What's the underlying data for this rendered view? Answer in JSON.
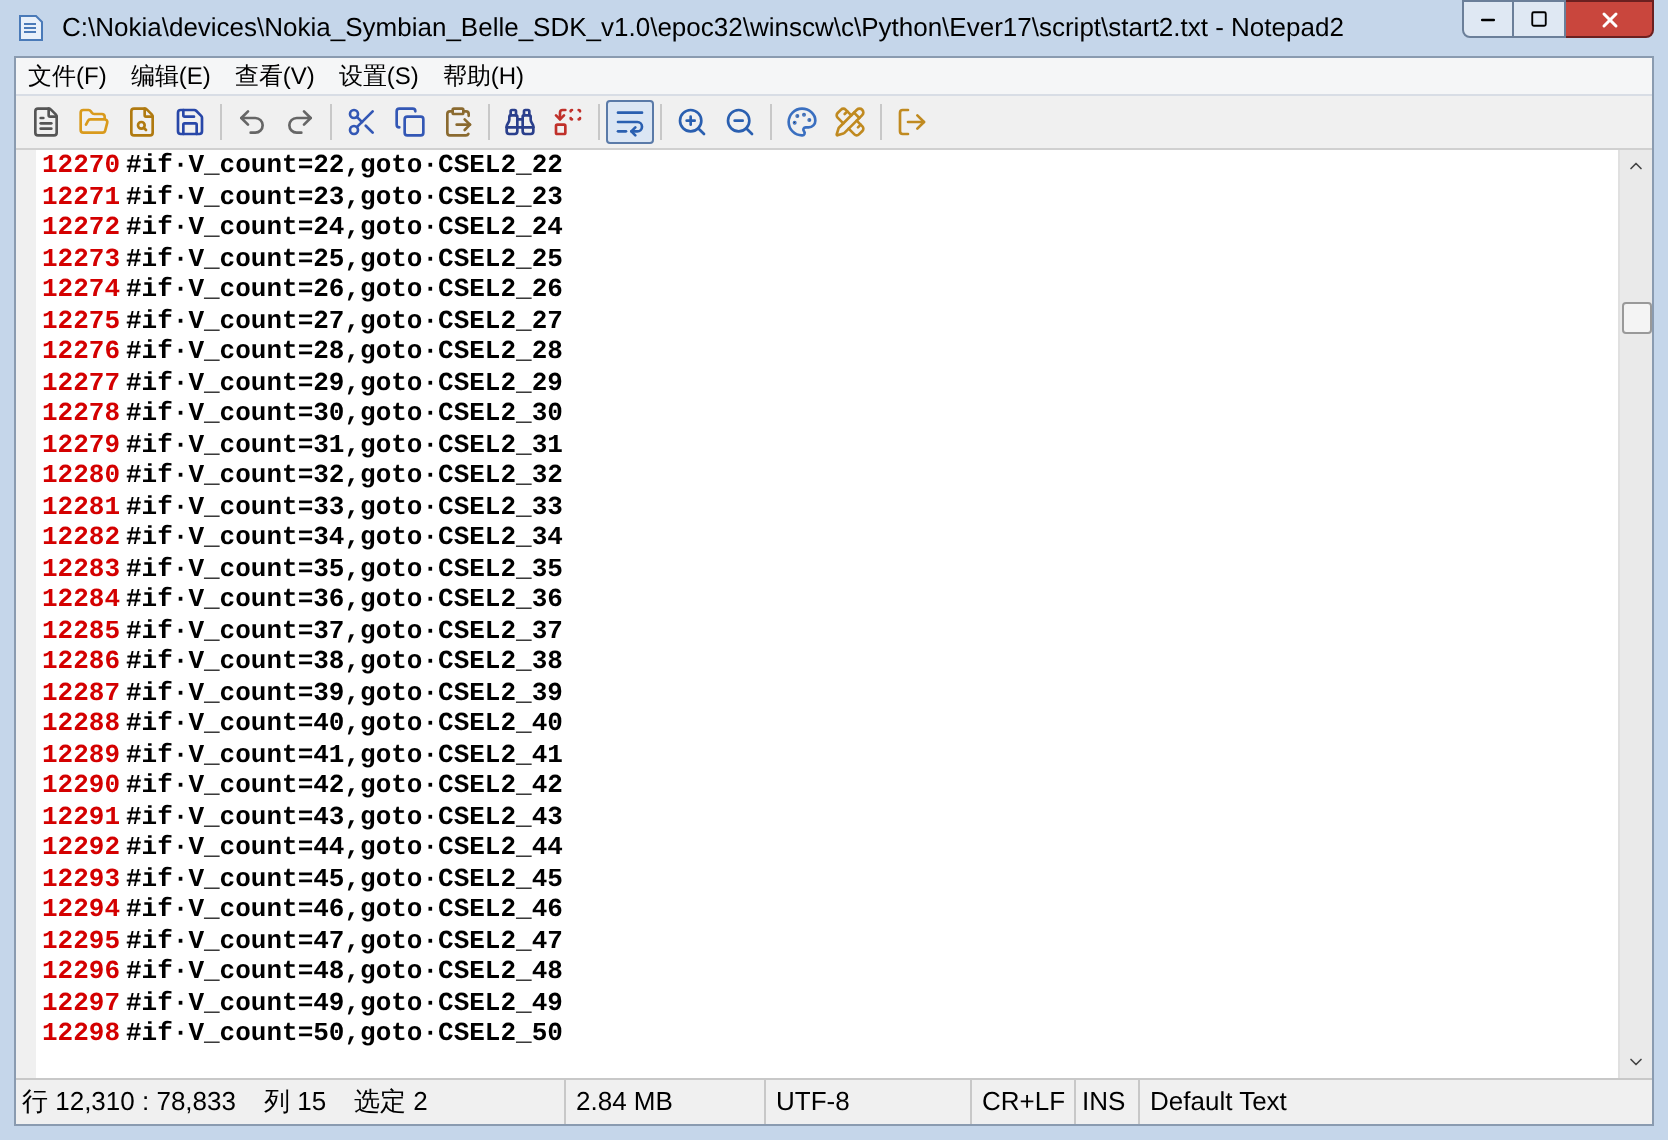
{
  "window": {
    "title": "C:\\Nokia\\devices\\Nokia_Symbian_Belle_SDK_v1.0\\epoc32\\winscw\\c\\Python\\Ever17\\script\\start2.txt - Notepad2"
  },
  "menu": [
    "文件(F)",
    "编辑(E)",
    "查看(V)",
    "设置(S)",
    "帮助(H)"
  ],
  "toolbar": [
    {
      "kind": "new",
      "pressed": false
    },
    {
      "kind": "open",
      "pressed": false
    },
    {
      "kind": "browse",
      "pressed": false
    },
    {
      "kind": "save",
      "pressed": false
    },
    {
      "kind": "sep"
    },
    {
      "kind": "undo",
      "pressed": false
    },
    {
      "kind": "redo",
      "pressed": false
    },
    {
      "kind": "sep"
    },
    {
      "kind": "cut",
      "pressed": false
    },
    {
      "kind": "copy",
      "pressed": false
    },
    {
      "kind": "paste",
      "pressed": false
    },
    {
      "kind": "sep"
    },
    {
      "kind": "find",
      "pressed": false
    },
    {
      "kind": "replace",
      "pressed": false
    },
    {
      "kind": "sep"
    },
    {
      "kind": "wrap",
      "pressed": true
    },
    {
      "kind": "sep"
    },
    {
      "kind": "zoomin",
      "pressed": false
    },
    {
      "kind": "zoomout",
      "pressed": false
    },
    {
      "kind": "sep"
    },
    {
      "kind": "scheme",
      "pressed": false
    },
    {
      "kind": "customize",
      "pressed": false
    },
    {
      "kind": "sep"
    },
    {
      "kind": "exit",
      "pressed": false
    }
  ],
  "editor": {
    "lines": [
      {
        "number": "12270",
        "text": "#if·V_count=22,goto·CSEL2_22"
      },
      {
        "number": "12271",
        "text": "#if·V_count=23,goto·CSEL2_23"
      },
      {
        "number": "12272",
        "text": "#if·V_count=24,goto·CSEL2_24"
      },
      {
        "number": "12273",
        "text": "#if·V_count=25,goto·CSEL2_25"
      },
      {
        "number": "12274",
        "text": "#if·V_count=26,goto·CSEL2_26"
      },
      {
        "number": "12275",
        "text": "#if·V_count=27,goto·CSEL2_27"
      },
      {
        "number": "12276",
        "text": "#if·V_count=28,goto·CSEL2_28"
      },
      {
        "number": "12277",
        "text": "#if·V_count=29,goto·CSEL2_29"
      },
      {
        "number": "12278",
        "text": "#if·V_count=30,goto·CSEL2_30"
      },
      {
        "number": "12279",
        "text": "#if·V_count=31,goto·CSEL2_31"
      },
      {
        "number": "12280",
        "text": "#if·V_count=32,goto·CSEL2_32"
      },
      {
        "number": "12281",
        "text": "#if·V_count=33,goto·CSEL2_33"
      },
      {
        "number": "12282",
        "text": "#if·V_count=34,goto·CSEL2_34"
      },
      {
        "number": "12283",
        "text": "#if·V_count=35,goto·CSEL2_35"
      },
      {
        "number": "12284",
        "text": "#if·V_count=36,goto·CSEL2_36"
      },
      {
        "number": "12285",
        "text": "#if·V_count=37,goto·CSEL2_37"
      },
      {
        "number": "12286",
        "text": "#if·V_count=38,goto·CSEL2_38"
      },
      {
        "number": "12287",
        "text": "#if·V_count=39,goto·CSEL2_39"
      },
      {
        "number": "12288",
        "text": "#if·V_count=40,goto·CSEL2_40"
      },
      {
        "number": "12289",
        "text": "#if·V_count=41,goto·CSEL2_41"
      },
      {
        "number": "12290",
        "text": "#if·V_count=42,goto·CSEL2_42"
      },
      {
        "number": "12291",
        "text": "#if·V_count=43,goto·CSEL2_43"
      },
      {
        "number": "12292",
        "text": "#if·V_count=44,goto·CSEL2_44"
      },
      {
        "number": "12293",
        "text": "#if·V_count=45,goto·CSEL2_45"
      },
      {
        "number": "12294",
        "text": "#if·V_count=46,goto·CSEL2_46"
      },
      {
        "number": "12295",
        "text": "#if·V_count=47,goto·CSEL2_47"
      },
      {
        "number": "12296",
        "text": "#if·V_count=48,goto·CSEL2_48"
      },
      {
        "number": "12297",
        "text": "#if·V_count=49,goto·CSEL2_49"
      },
      {
        "number": "12298",
        "text": "#if·V_count=50,goto·CSEL2_50"
      }
    ]
  },
  "status_bar": {
    "position": "行 12,310 : 78,833",
    "column": "列 15",
    "selection": "选定 2",
    "size": "2.84 MB",
    "encoding": "UTF-8",
    "line_endings": "CR+LF",
    "mode": "INS",
    "scheme": "Default Text"
  }
}
